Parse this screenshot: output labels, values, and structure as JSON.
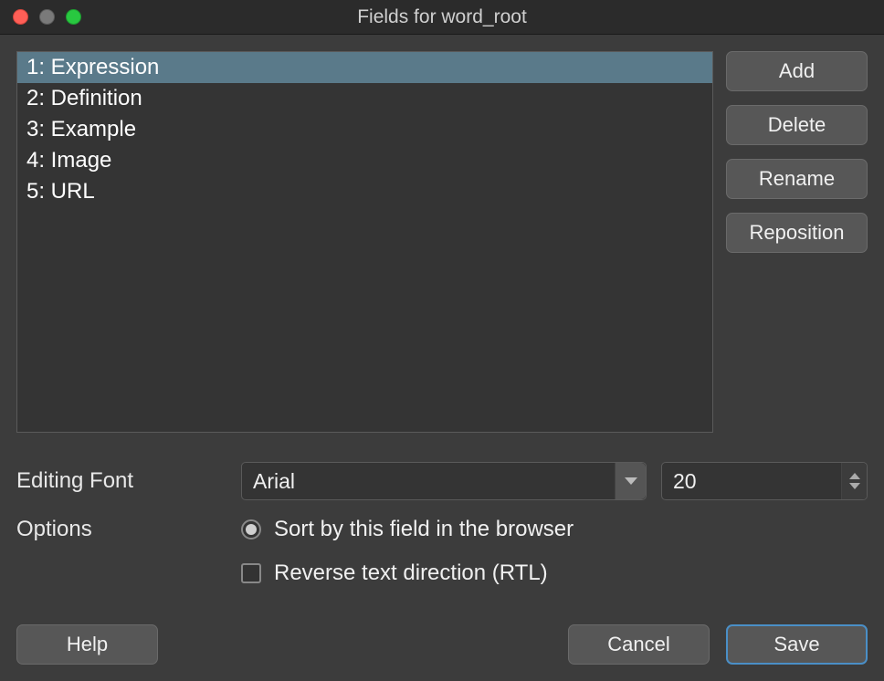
{
  "window": {
    "title": "Fields for word_root"
  },
  "fields": {
    "items": [
      {
        "label": "1: Expression",
        "selected": true
      },
      {
        "label": "2: Definition",
        "selected": false
      },
      {
        "label": "3: Example",
        "selected": false
      },
      {
        "label": "4: Image",
        "selected": false
      },
      {
        "label": "5: URL",
        "selected": false
      }
    ]
  },
  "buttons": {
    "add": "Add",
    "delete": "Delete",
    "rename": "Rename",
    "reposition": "Reposition",
    "help": "Help",
    "cancel": "Cancel",
    "save": "Save"
  },
  "form": {
    "editing_font_label": "Editing Font",
    "font_name": "Arial",
    "font_size": "20",
    "options_label": "Options",
    "sort_label": "Sort by this field in the browser",
    "sort_checked": true,
    "rtl_label": "Reverse text direction (RTL)",
    "rtl_checked": false
  }
}
